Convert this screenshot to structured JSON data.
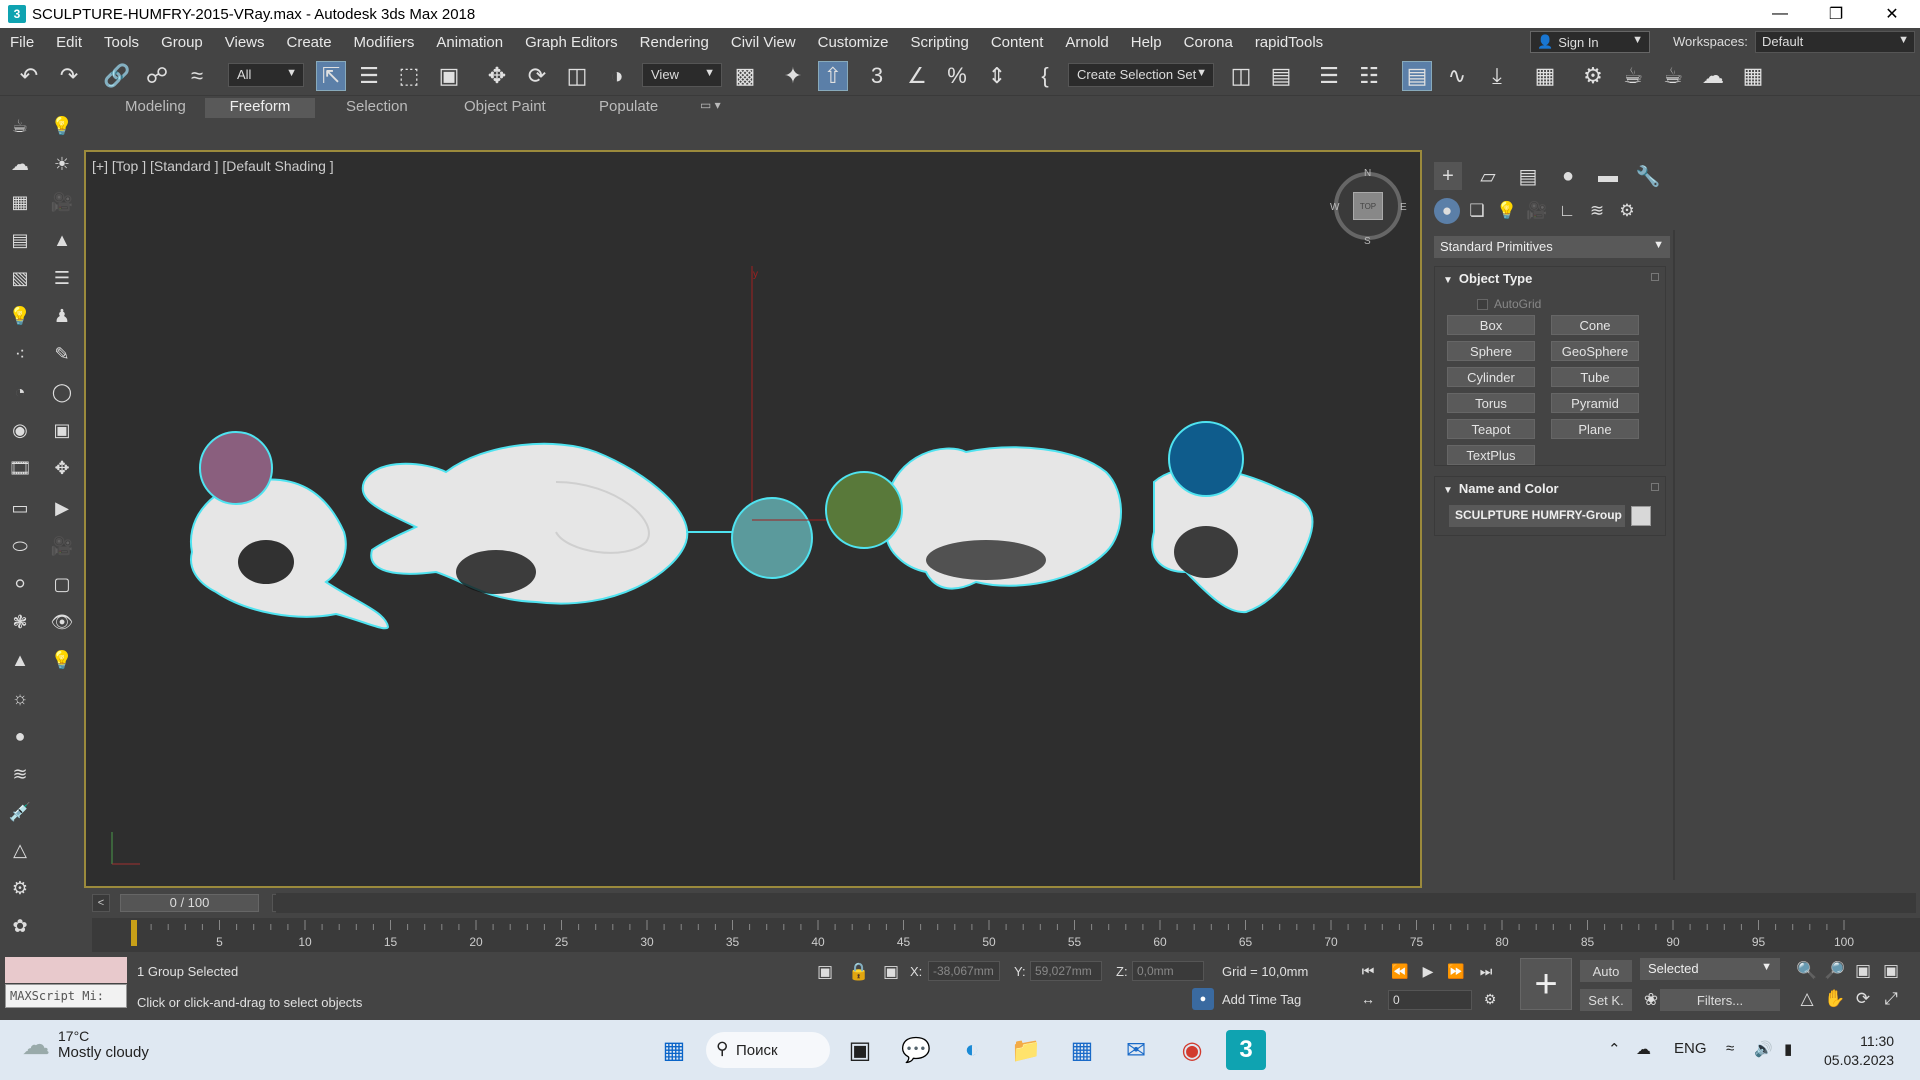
{
  "window": {
    "title": "SCULPTURE-HUMFRY-2015-VRay.max - Autodesk 3ds Max 2018",
    "app_icon": "3",
    "controls": [
      "minimize-icon",
      "restore-icon",
      "close-icon"
    ]
  },
  "menu": [
    "File",
    "Edit",
    "Tools",
    "Group",
    "Views",
    "Create",
    "Modifiers",
    "Animation",
    "Graph Editors",
    "Rendering",
    "Civil View",
    "Customize",
    "Scripting",
    "Content",
    "Arnold",
    "Help",
    "Corona",
    "rapidTools"
  ],
  "account": {
    "sign_in": "Sign In",
    "workspaces_label": "Workspaces:",
    "workspace": "Default"
  },
  "toolbar": {
    "filter": "All",
    "ref_coord": "View",
    "selection_set": "Create Selection Set"
  },
  "ribbon": {
    "tabs": [
      "Modeling",
      "Freeform",
      "Selection",
      "Object Paint",
      "Populate"
    ],
    "active": "Freeform"
  },
  "viewport": {
    "label": "[+] [Top ] [Standard ] [Default Shading ]",
    "compass": {
      "n": "N",
      "s": "S",
      "e": "E",
      "w": "W"
    },
    "cube_label": "TOP",
    "colors": {
      "selection_outline": "#4fe3f0",
      "ball_1": "#8a5f7e",
      "ball_2": "#5b9a9c",
      "ball_3": "#59793a",
      "ball_4": "#0f5c8c",
      "bear": "#e6e6e6",
      "y_axis": "#a02020",
      "x_axis": "#a02020"
    }
  },
  "command_panel": {
    "primitive_type": "Standard Primitives",
    "object_type": {
      "title": "Object Type",
      "autogrid": "AutoGrid",
      "buttons": [
        "Box",
        "Cone",
        "Sphere",
        "GeoSphere",
        "Cylinder",
        "Tube",
        "Torus",
        "Pyramid",
        "Teapot",
        "Plane",
        "TextPlus"
      ]
    },
    "name_and_color": {
      "title": "Name and Color",
      "name": "SCULPTURE HUMFRY-Group",
      "color": "#d8d8d8"
    }
  },
  "timeline": {
    "frame_display": "0 / 100",
    "ticks": [
      "5",
      "10",
      "15",
      "20",
      "25",
      "30",
      "35",
      "40",
      "45",
      "50",
      "55",
      "60",
      "65",
      "70",
      "75",
      "80",
      "85",
      "90",
      "95",
      "100"
    ],
    "frame_start": 0,
    "frame_end": 100,
    "current_frame": 0
  },
  "status": {
    "maxscript": "MAXScript Mi:",
    "selection": "1 Group Selected",
    "prompt": "Click or click-and-drag to select objects",
    "x_label": "X:",
    "x_value": "-38,067mm",
    "y_label": "Y:",
    "y_value": "59,027mm",
    "z_label": "Z:",
    "z_value": "0,0mm",
    "grid": "Grid = 10,0mm",
    "add_time_tag": "Add Time Tag",
    "frame_field": "0",
    "auto": "Auto",
    "set_key": "Set K.",
    "key_mode": "Selected",
    "filters": "Filters..."
  },
  "taskbar": {
    "temperature": "17°C",
    "weather": "Mostly cloudy",
    "search": "Поиск",
    "lang": "ENG",
    "time": "11:30",
    "date": "05.03.2023"
  }
}
